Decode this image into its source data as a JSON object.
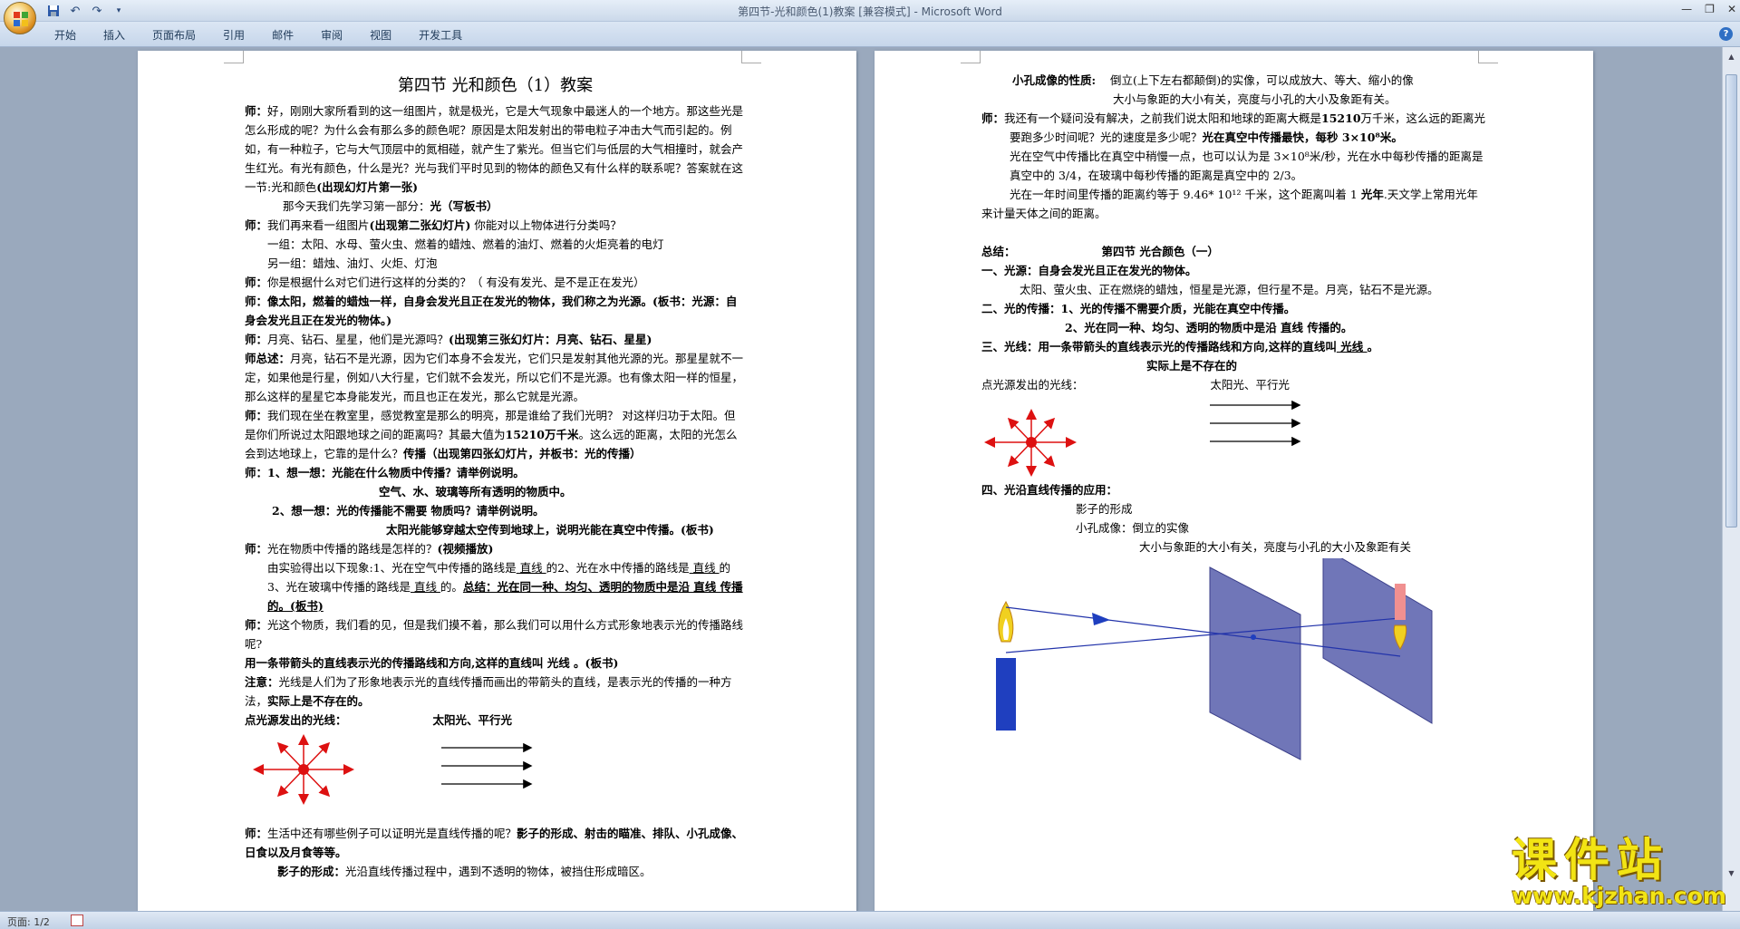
{
  "window": {
    "title": "第四节-光和颜色(1)教案 [兼容模式] - Microsoft Word"
  },
  "ribbon": {
    "tabs": [
      "开始",
      "插入",
      "页面布局",
      "引用",
      "邮件",
      "审阅",
      "视图",
      "开发工具"
    ]
  },
  "status": {
    "page": "页面: 1/2"
  },
  "watermark": {
    "text": "课件站",
    "url": "www.kjzhan.com"
  },
  "page1": {
    "title": "第四节  光和颜色（1）教案",
    "p1a": "师：",
    "p1b": "好，刚刚大家所看到的这一组图片，就是极光，它是大气现象中最迷人的一个地方。那这些光是怎么形成的呢？为什么会有那么多的颜色呢？原因是太阳发射出的带电粒子冲击大气而引起的。例如，有一种粒子，它与大气顶层中的氮相碰，就产生了紫光。但当它们与低层的大气相撞时，就会产生红光。有光有颜色，什么是光？光与我们平时见到的物体的颜色又有什么样的联系呢？答案就在这一节:光和颜色",
    "p1c": "(出现幻灯片第一张)",
    "p2a": "那今天我们先学习第一部分：",
    "p2b": "光（写板书）",
    "p3a": "师：",
    "p3b": "我们再来看一组图片",
    "p3c": "(出现第二张幻灯片)",
    "p3d": "    你能对以上物体进行分类吗？",
    "p4": "一组：太阳、水母、萤火虫、燃着的蜡烛、燃着的油灯、燃着的火炬亮着的电灯",
    "p5": "另一组：蜡烛、油灯、火炬、灯泡",
    "p6a": "师：",
    "p6b": "你是根据什么对它们进行这样的分类的？（   有没有发光、是不是正在发光）",
    "p7": "师：像太阳，燃着的蜡烛一样，自身会发光且正在发光的物体，我们称之为光源。(板书：光源：自身会发光且正在发光的物体。)",
    "p8a": "师：",
    "p8b": "月亮、钻石、星星，他们是光源吗？",
    "p8c": "(出现第三张幻灯片：月亮、钻石、星星)",
    "p9a": "师总述：",
    "p9b": "月亮，钻石不是光源，因为它们本身不会发光，它们只是发射其他光源的光。那星星就不一定，如果他是行星，例如八大行星，它们就不会发光，所以它们不是光源。也有像太阳一样的恒星，那么这样的星星它本身能发光，而且也正在发光，那么它就是光源。",
    "p10a": "师：",
    "p10b": "我们现在坐在教室里，感觉教室是那么的明亮，那是谁给了我们光明？   对这样归功于太阳。但是你们所说过太阳跟地球之间的距离吗？其最大值为",
    "p10c": "15210万千米",
    "p10d": "。这么远的距离，太阳的光怎么会到达地球上，它靠的是什么？",
    "p10e": "传播（出现第四张幻灯片，并板书：光的传播）",
    "p11": "师：1、想一想：光能在什么物质中传播？请举例说明。",
    "p12": "空气、水、玻璃等所有透明的物质中。",
    "p13": "2、想一想：光的传播能不需要 物质吗？请举例说明。",
    "p14": "太阳光能够穿越太空传到地球上，说明光能在真空中传播。(板书)",
    "p15a": "师：",
    "p15b": "光在物质中传播的路线是怎样的？",
    "p15c": "(视频播放)",
    "p16a": "由实验得出以下现象:1、光在空气中传播的路线是",
    "p16b": "  直线  ",
    "p16c": "的2、光在水中传播的路线是",
    "p16d": "  直线  ",
    "p16e": "的3、光在玻璃中传播的路线是",
    "p16f": "  直线  ",
    "p16g": "的。",
    "p16h": "总结：光在同一种、均匀、透明的物质中是沿 直线 传播的。(板书)",
    "p17a": "师：",
    "p17b": "光这个物质，我们看的见，但是我们摸不着，那么我们可以用什么方式形象地表示光的传播路线呢?",
    "p18": "用一条带箭头的直线表示光的传播路线和方向,这样的直线叫  光线  。(板书)",
    "p19a": "注意：",
    "p19b": "光线是人们为了形象地表示光的直线传播而画出的带箭头的直线，是表示光的传播的一种方法，",
    "p19c": "实际上是不存在的。",
    "p20a": "点光源发出的光线：",
    "p20b": "太阳光、平行光",
    "p21a": "师：",
    "p21b": "生活中还有哪些例子可以证明光是直线传播的呢？",
    "p21c": "影子的形成、射击的瞄准、排队、小孔成像、日食以及月食等等。",
    "p22a": "影子的形成：",
    "p22b": "光沿直线传播过程中，遇到不透明的物体，被挡住形成暗区。"
  },
  "page2": {
    "q1a": "小孔成像的性质:",
    "q1b": "倒立(上下左右都颠倒)的实像，可以成放大、等大、缩小的像",
    "q2": "大小与象距的大小有关，亮度与小孔的大小及象距有关。",
    "q3a": "师：",
    "q3b": "我还有一个疑问没有解决，之前我们说太阳和地球的距离大概是",
    "q3c": "15210",
    "q3d": "万千米，这么远的距离光要跑多少时间呢？光的速度是多少呢？",
    "q3e": "光在真空中传播最快，每秒 3×10⁸米。",
    "q4": "光在空气中传播比在真空中稍慢一点，也可以认为是 3×10⁸米/秒，光在水中每秒传播的距离是真空中的 3/4，在玻璃中每秒传播的距离是真空中的 2/3。",
    "q5a": "光在一年时间里传播的距离约等于 9.46* 10¹² 千米，这个距离叫着 1 ",
    "q5b": "光年",
    "q5c": ".天文学上常用光年来计量天体之间的距离。",
    "q6a": "总结：",
    "q6b": "第四节 光合颜色（一）",
    "q7": "一、光源：自身会发光且正在发光的物体。",
    "q8": "太阳、萤火虫、正在燃烧的蜡烛，恒星是光源，但行星不是。月亮，钻石不是光源。",
    "q9": "二、光的传播：1、光的传播不需要介质，光能在真空中传播。",
    "q10": "2、光在同一种、均匀、透明的物质中是沿 直线 传播的。",
    "q11a": "三、光线：用一条带箭头的直线表示光的传播路线和方向,这样的直线叫",
    "q11b": "  光线  ",
    "q11c": "。",
    "q12": "实际上是不存在的",
    "q13a": "点光源发出的光线：",
    "q13b": "太阳光、平行光",
    "q14": "四、光沿直线传播的应用：",
    "q15": "影子的形成",
    "q16": "小孔成像：倒立的实像",
    "q17": "大小与象距的大小有关，亮度与小孔的大小及象距有关"
  }
}
